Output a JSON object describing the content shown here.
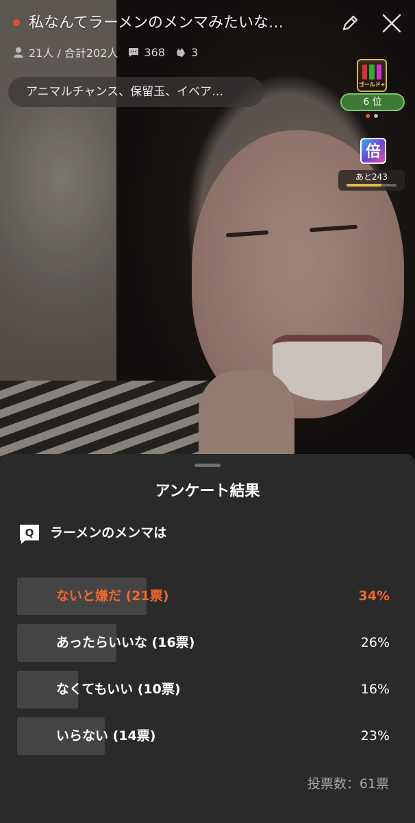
{
  "stream": {
    "title": "私なんてラーメンのメンマみたいな…",
    "viewers": "21人 / 合計202人",
    "comments": "368",
    "claps": "3",
    "tags": "アニマルチャンス、保留玉、イベア…",
    "live_color": "#e0531e"
  },
  "widgets": {
    "gold_label": "ゴールド+",
    "rank": "6 位",
    "bai_glyph": "倍",
    "remaining": "あと243",
    "remaining_progress": 0.7
  },
  "poll": {
    "heading": "アンケート結果",
    "question_icon": "Q",
    "question": "ラーメンのメンマは",
    "options": [
      {
        "label": "ないと嫌だ (21票)",
        "percent": "34%",
        "share": 0.34,
        "top": true
      },
      {
        "label": "あったらいいな (16票)",
        "percent": "26%",
        "share": 0.26,
        "top": false
      },
      {
        "label": "なくてもいい (10票)",
        "percent": "16%",
        "share": 0.16,
        "top": false
      },
      {
        "label": "いらない (14票)",
        "percent": "23%",
        "share": 0.23,
        "top": false
      }
    ],
    "total": "投票数：61票",
    "accent_color": "#f2692f"
  },
  "icons": [
    "person-icon",
    "comment-icon",
    "clap-icon",
    "pencil-icon",
    "close-icon",
    "question-icon"
  ]
}
